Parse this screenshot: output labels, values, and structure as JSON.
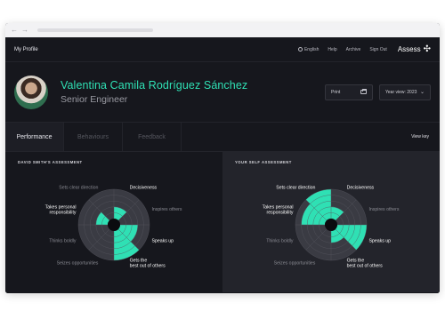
{
  "browser": {
    "back": "←",
    "forward": "→"
  },
  "topbar": {
    "title": "My Profile",
    "language": "English",
    "help": "Help",
    "archive": "Archive",
    "sign_out": "Sign Out",
    "logo_text": "Assess"
  },
  "profile": {
    "name": "Valentina Camila Rodríguez Sánchez",
    "role": "Senior Engineer"
  },
  "actions": {
    "print_label": "Print",
    "year_label": "Year view: 2023"
  },
  "tabs": [
    {
      "label": "Performance",
      "active": true
    },
    {
      "label": "Behaviours",
      "active": false
    },
    {
      "label": "Feedback",
      "active": false
    }
  ],
  "view_key": "View key",
  "colors": {
    "accent": "#2fe0b4",
    "ring": "#3a3b43",
    "grid": "#55565e"
  },
  "assessments": [
    {
      "title": "DAVID SMITH'S ASSESSMENT",
      "labels": [
        "Decisiveness",
        "Inspires others",
        "Speaks up",
        "Gets the best out of others",
        "Seizes opportunities",
        "Thinks boldly",
        "Takes personal responsibility",
        "Sets clear direction"
      ],
      "highlighted": [
        true,
        false,
        true,
        true,
        false,
        false,
        true,
        false
      ],
      "levels": [
        2,
        0,
        3,
        5,
        0,
        0,
        2,
        0
      ]
    },
    {
      "title": "YOUR SELF ASSESSMENT",
      "labels": [
        "Decisiveness",
        "Inspires others",
        "Speaks up",
        "Gets the best out of others",
        "Seizes opportunities",
        "Thinks boldly",
        "Takes personal responsibility",
        "Sets clear direction"
      ],
      "highlighted": [
        true,
        false,
        true,
        true,
        false,
        false,
        true,
        true
      ],
      "levels": [
        2,
        0,
        5,
        2,
        0,
        0,
        4,
        5
      ]
    }
  ]
}
